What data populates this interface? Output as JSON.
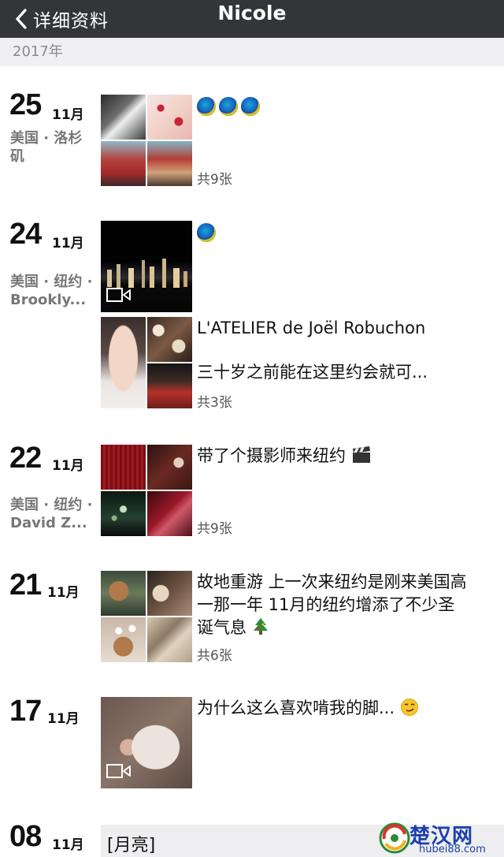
{
  "nav": {
    "back_label": "详细资料",
    "title": "Nicole"
  },
  "year": "2017年",
  "posts": [
    {
      "day": "25",
      "month": "11月",
      "location": "美国 · 洛杉矶",
      "text": "",
      "count": "共9张"
    },
    {
      "day": "24",
      "month": "11月",
      "location": "美国 · 纽约 · Brookly...",
      "text": ""
    },
    {
      "text_line1": "L'ATELIER de Joël Robuchon",
      "text_line2": "三十岁之前能在这里约会就可...",
      "count": "共3张"
    },
    {
      "day": "22",
      "month": "11月",
      "location": "美国 · 纽约 · David Z...",
      "text": "带了个摄影师来纽约",
      "count": "共9张"
    },
    {
      "day": "21",
      "month": "11月",
      "text": "故地重游 上一次来纽约是刚来美国高一那一年 11月的纽约增添了不少圣诞气息",
      "count": "共6张"
    },
    {
      "day": "17",
      "month": "11月",
      "text": "为什么这么喜欢啃我的脚..."
    },
    {
      "day": "08",
      "month": "11月",
      "text": "[月亮]"
    }
  ],
  "watermark": {
    "name": "楚汉网",
    "url": "hubei88.com"
  },
  "colors": {
    "navbar": "#333538",
    "year_bar": "#efeff4",
    "text": "#111111",
    "location": "#777777"
  }
}
